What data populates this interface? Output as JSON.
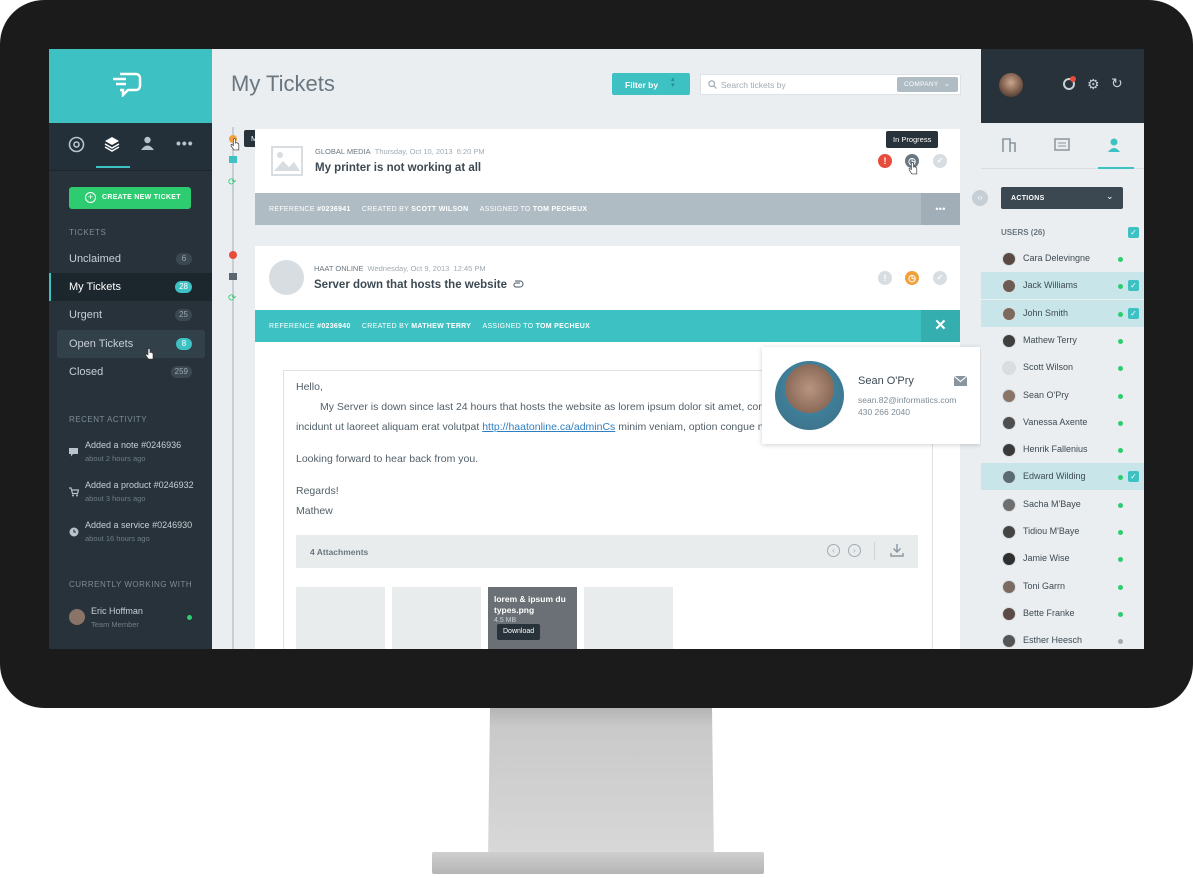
{
  "colors": {
    "accent": "#3ec1c2",
    "sidebar": "#27323a",
    "green": "#2ecc71",
    "red": "#e74c3c",
    "orange": "#f0a03c"
  },
  "main": {
    "title": "My Tickets",
    "filter_label": "Filter by",
    "search_placeholder": "Search tickets by",
    "company_label": "COMPANY"
  },
  "timeline": {
    "priority_tooltip": "Medium Priority"
  },
  "sidebar": {
    "create_label": "CREATE NEW TICKET",
    "tickets_header": "TICKETS",
    "items": [
      {
        "label": "Unclaimed",
        "count": "6"
      },
      {
        "label": "My Tickets",
        "count": "28"
      },
      {
        "label": "Urgent",
        "count": "25"
      },
      {
        "label": "Open Tickets",
        "count": "8"
      },
      {
        "label": "Closed",
        "count": "259"
      }
    ],
    "recent_header": "RECENT ACTIVITY",
    "activity": [
      {
        "title": "Added a note",
        "ref": "#0246936",
        "time": "about 2 hours ago",
        "icon": "comment-icon"
      },
      {
        "title": "Added a product",
        "ref": "#0246932",
        "time": "about 3 hours ago",
        "icon": "cart-icon"
      },
      {
        "title": "Added a service",
        "ref": "#0246930",
        "time": "about 16 hours ago",
        "icon": "clock-icon"
      }
    ],
    "working_header": "CURRENTLY WORKING WITH",
    "working_name": "Eric Hoffman",
    "working_role": "Team Member"
  },
  "tickets": [
    {
      "company": "GLOBAL MEDIA",
      "date": "Thursday, Oct 10, 2013",
      "time": "6:20 PM",
      "subject": "My printer is not working at all",
      "status_tooltip": "In Progress",
      "ref_label": "REFERENCE",
      "ref": "#0236941",
      "created_label": "CREATED BY",
      "created_by": "SCOTT WILSON",
      "assigned_label": "ASSIGNED TO",
      "assigned_to": "TOM PECHEUX",
      "more": "•••"
    },
    {
      "company": "HAAT ONLINE",
      "date": "Wednesday, Oct 9, 2013",
      "time": "12:45 PM",
      "subject": "Server down that hosts the website",
      "ref_label": "REFERENCE",
      "ref": "#0236940",
      "created_label": "CREATED BY",
      "created_by": "MATHEW TERRY",
      "assigned_label": "ASSIGNED TO",
      "assigned_to": "TOM PECHEUX",
      "close": "✕",
      "body": {
        "greeting": "Hello,",
        "line1": "My Server is down since last 24 hours that hosts the website as lorem ipsum dolor sit amet, consec",
        "line2_pre": "incidunt ut laoreet aliquam erat volutpat ",
        "link": "http://haatonline.ca/adminCs",
        "line2_post": " minim veniam, option congue ni",
        "line3": "Looking forward to hear back from you.",
        "regards": "Regards!",
        "signature": "Mathew"
      },
      "attachments_label": "4 Attachments",
      "attachment_name": "lorem & ipsum du types.png",
      "attachment_size": "4.5 MB",
      "download_tooltip": "Download"
    }
  ],
  "contact_card": {
    "name": "Sean O'Pry",
    "email": "sean.82@informatics.com",
    "phone": "430 266 2040"
  },
  "right": {
    "actions_label": "ACTIONS",
    "users_header": "USERS (26)",
    "users": [
      {
        "name": "Cara Delevingne",
        "status": "online",
        "selected": false
      },
      {
        "name": "Jack Williams",
        "status": "online",
        "selected": true
      },
      {
        "name": "John Smith",
        "status": "online",
        "selected": true
      },
      {
        "name": "Mathew Terry",
        "status": "online",
        "selected": false
      },
      {
        "name": "Scott Wilson",
        "status": "online",
        "selected": false
      },
      {
        "name": "Sean O'Pry",
        "status": "online",
        "selected": false
      },
      {
        "name": "Vanessa Axente",
        "status": "online",
        "selected": false
      },
      {
        "name": "Henrik Fallenius",
        "status": "online",
        "selected": false
      },
      {
        "name": "Edward Wilding",
        "status": "online",
        "selected": true
      },
      {
        "name": "Sacha M'Baye",
        "status": "online",
        "selected": false
      },
      {
        "name": "Tidiou M'Baye",
        "status": "online",
        "selected": false
      },
      {
        "name": "Jamie Wise",
        "status": "online",
        "selected": false
      },
      {
        "name": "Toni Garrn",
        "status": "online",
        "selected": false
      },
      {
        "name": "Bette Franke",
        "status": "online",
        "selected": false
      },
      {
        "name": "Esther Heesch",
        "status": "offline",
        "selected": false
      }
    ]
  }
}
